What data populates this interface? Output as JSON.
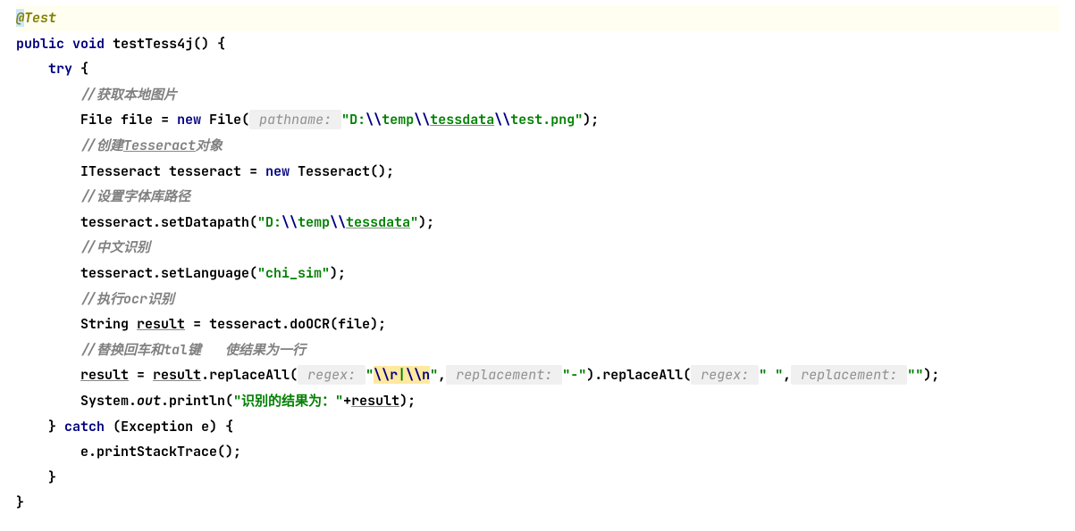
{
  "code": {
    "annotation_at": "@",
    "annotation_test": "Test",
    "kw_public": "public",
    "kw_void": "void",
    "method_name": "testTess4j",
    "paren_open": "()",
    "brace_open": " {",
    "kw_try": "try",
    "brace_open2": " {",
    "comment1": "//获取本地图片",
    "type_file": "File",
    "var_file": "file",
    "eq": " = ",
    "kw_new1": "new",
    "ctor_file": "File",
    "lparen1": "(",
    "hint_pathname": " pathname: ",
    "str_path": "\"D:",
    "esc_slash1": "\\\\",
    "str_temp": "temp",
    "esc_slash2": "\\\\",
    "str_tessdata": "tessdata",
    "esc_slash3": "\\\\",
    "str_testpng": "test.png\"",
    "rparen_semi1": ");",
    "comment2_a": "//创建",
    "comment2_b": "Tesseract",
    "comment2_c": "对象",
    "type_itess": "ITesseract",
    "var_tesseract": "tesseract",
    "kw_new2": "new",
    "ctor_tess": "Tesseract",
    "rparen_semi2": "();",
    "comment3": "//设置字体库路径",
    "call_setdata": "tesseract.setDatapath(",
    "str_path2a": "\"D:",
    "esc_slash4": "\\\\",
    "str_temp2": "temp",
    "esc_slash5": "\\\\",
    "str_tessdata2": "tessdata",
    "str_path2end": "\"",
    "rparen_semi3": ");",
    "comment4": "//中文识别",
    "call_setlang": "tesseract.setLanguage(",
    "str_chisim": "\"chi_sim\"",
    "rparen_semi4": ");",
    "comment5_a": "//执行",
    "comment5_b": "ocr",
    "comment5_c": "识别",
    "type_string": "String",
    "var_result": "result",
    "eq2": " = ",
    "call_doocr": "tesseract.doOCR(file);",
    "comment6_a": "//替换回车和",
    "comment6_b": "tal",
    "comment6_c": "键   使结果为一行",
    "var_result2": "result",
    "eq3": " = ",
    "var_result3": "result",
    "call_replace1": ".replaceAll(",
    "hint_regex1": " regex: ",
    "str_q1": "\"",
    "str_regex_r": "\\\\r",
    "str_pipe": "|",
    "str_regex_n": "\\\\n",
    "str_q2": "\"",
    "comma1": ",",
    "hint_replacement1": " replacement: ",
    "str_dash": "\"-\"",
    "rparen1": ")",
    "call_replace2": ".replaceAll(",
    "hint_regex2": " regex: ",
    "str_space": "\" \"",
    "comma2": ",",
    "hint_replacement2": " replacement: ",
    "str_empty": "\"\"",
    "rparen_semi5": ");",
    "sys": "System.",
    "out": "out",
    "println": ".println(",
    "str_output": "\"识别的结果为：\"",
    "plus": "+",
    "var_result4": "result",
    "rparen_semi6": ");",
    "brace_close1": "}",
    "kw_catch": "catch",
    "catch_params": " (Exception e) {",
    "call_print": "e.printStackTrace();",
    "brace_close2": "}",
    "brace_close3": "}"
  }
}
